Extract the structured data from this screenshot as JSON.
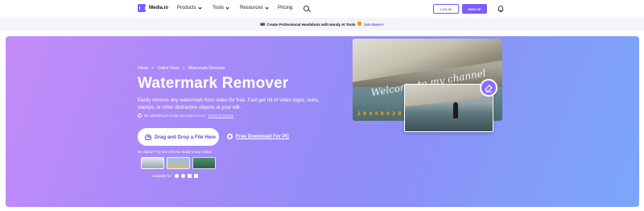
{
  "nav": {
    "brand": "Media.io",
    "items": [
      {
        "label": "Products",
        "dropdown": true
      },
      {
        "label": "Tools",
        "dropdown": true
      },
      {
        "label": "Resources",
        "dropdown": true
      },
      {
        "label": "Pricing",
        "dropdown": false
      }
    ],
    "login_label": "LOG IN",
    "signup_label": "SIGN UP"
  },
  "promo": {
    "text": "Create Professional Headshots with Handy AI Tools",
    "link": "Join Now>>"
  },
  "hero": {
    "breadcrumb": [
      "Home",
      ">",
      "Online Tools",
      ">",
      "Watermark Remover"
    ],
    "title": "Watermark Remover",
    "description": "Easily remove any watermark from video for free. Fast get rid of video logos, texts, stamps, or other distractive objects at your will.",
    "terms_prefix": "By uploading an image you agree to our",
    "terms_link": "Terms of Service",
    "drag_button": "Drag and Drop a File Here",
    "download_link": "Free Download For PC",
    "samples_label": "No videos? Try one of these ready-to-use videos",
    "available_label": "Available for:"
  },
  "media": {
    "watermark_text": "Welcome to my channel",
    "watermark_date": "2 0 0 4  0 4  2 0  2 0"
  },
  "colors": {
    "accent": "#7b5cff",
    "hero_gradient_start": "#c58cf9",
    "hero_gradient_end": "#7aa8fa",
    "date_stamp": "#ffae00"
  }
}
